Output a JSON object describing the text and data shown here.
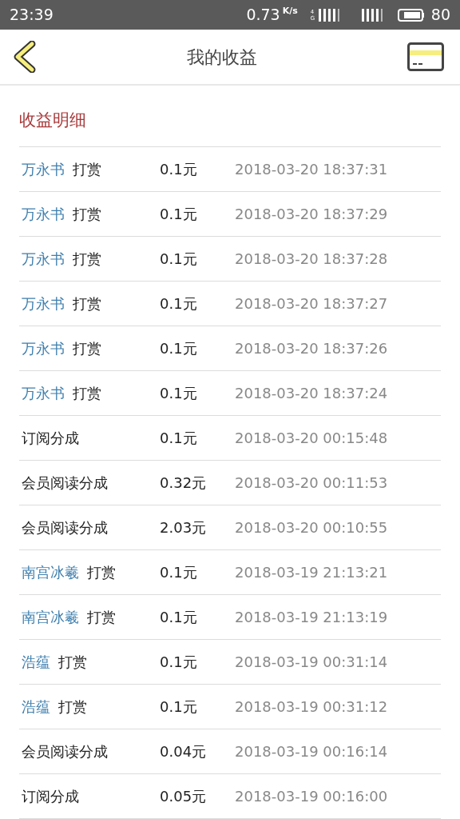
{
  "status_bar": {
    "time": "23:39",
    "speed": "0.73",
    "speed_unit": "K/s",
    "network": "4G",
    "battery": "80"
  },
  "header": {
    "title": "我的收益"
  },
  "section_title": "收益明细",
  "records": [
    {
      "kind": "reward",
      "sender": "万永书",
      "action": "打赏",
      "amount": "0.1元",
      "time": "2018-03-20 18:37:31"
    },
    {
      "kind": "reward",
      "sender": "万永书",
      "action": "打赏",
      "amount": "0.1元",
      "time": "2018-03-20 18:37:29"
    },
    {
      "kind": "reward",
      "sender": "万永书",
      "action": "打赏",
      "amount": "0.1元",
      "time": "2018-03-20 18:37:28"
    },
    {
      "kind": "reward",
      "sender": "万永书",
      "action": "打赏",
      "amount": "0.1元",
      "time": "2018-03-20 18:37:27"
    },
    {
      "kind": "reward",
      "sender": "万永书",
      "action": "打赏",
      "amount": "0.1元",
      "time": "2018-03-20 18:37:26"
    },
    {
      "kind": "reward",
      "sender": "万永书",
      "action": "打赏",
      "amount": "0.1元",
      "time": "2018-03-20 18:37:24"
    },
    {
      "kind": "share",
      "action": "订阅分成",
      "amount": "0.1元",
      "time": "2018-03-20 00:15:48"
    },
    {
      "kind": "share",
      "action": "会员阅读分成",
      "amount": "0.32元",
      "time": "2018-03-20 00:11:53"
    },
    {
      "kind": "share",
      "action": "会员阅读分成",
      "amount": "2.03元",
      "time": "2018-03-20 00:10:55"
    },
    {
      "kind": "reward",
      "sender": "南宫冰羲",
      "action": "打赏",
      "amount": "0.1元",
      "time": "2018-03-19 21:13:21"
    },
    {
      "kind": "reward",
      "sender": "南宫冰羲",
      "action": "打赏",
      "amount": "0.1元",
      "time": "2018-03-19 21:13:19"
    },
    {
      "kind": "reward",
      "sender": "浩蕴",
      "action": "打赏",
      "amount": "0.1元",
      "time": "2018-03-19 00:31:14"
    },
    {
      "kind": "reward",
      "sender": "浩蕴",
      "action": "打赏",
      "amount": "0.1元",
      "time": "2018-03-19 00:31:12"
    },
    {
      "kind": "share",
      "action": "会员阅读分成",
      "amount": "0.04元",
      "time": "2018-03-19 00:16:14"
    },
    {
      "kind": "share",
      "action": "订阅分成",
      "amount": "0.05元",
      "time": "2018-03-19 00:16:00"
    }
  ]
}
